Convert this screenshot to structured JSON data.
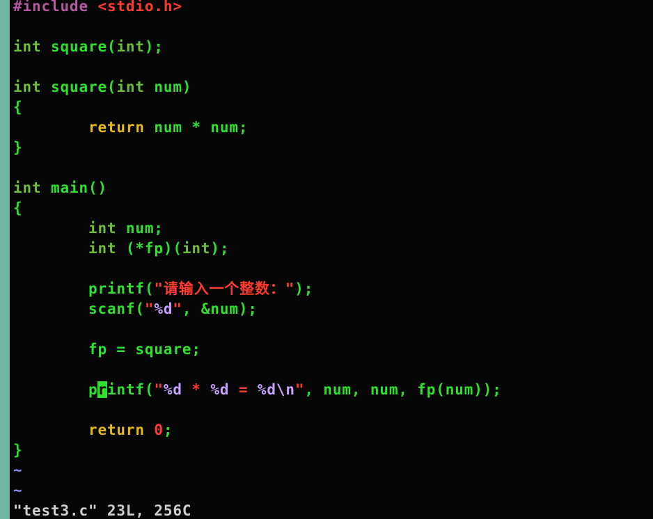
{
  "editor": {
    "lines": [
      {
        "indent": "",
        "tokens": [
          {
            "t": "#include ",
            "c": "pre"
          },
          {
            "t": "<stdio.h>",
            "c": "inc"
          }
        ]
      },
      {
        "indent": "",
        "tokens": []
      },
      {
        "indent": "",
        "tokens": [
          {
            "t": "int",
            "c": "type"
          },
          {
            "t": " square(",
            "c": "op"
          },
          {
            "t": "int",
            "c": "type"
          },
          {
            "t": ");",
            "c": "op"
          }
        ]
      },
      {
        "indent": "",
        "tokens": []
      },
      {
        "indent": "",
        "tokens": [
          {
            "t": "int",
            "c": "type"
          },
          {
            "t": " square(",
            "c": "op"
          },
          {
            "t": "int",
            "c": "type"
          },
          {
            "t": " num)",
            "c": "op"
          }
        ]
      },
      {
        "indent": "",
        "tokens": [
          {
            "t": "{",
            "c": "op"
          }
        ]
      },
      {
        "indent": "        ",
        "tokens": [
          {
            "t": "return",
            "c": "kw"
          },
          {
            "t": " num * num;",
            "c": "op"
          }
        ]
      },
      {
        "indent": "",
        "tokens": [
          {
            "t": "}",
            "c": "op"
          }
        ]
      },
      {
        "indent": "",
        "tokens": []
      },
      {
        "indent": "",
        "tokens": [
          {
            "t": "int",
            "c": "type"
          },
          {
            "t": " main()",
            "c": "op"
          }
        ]
      },
      {
        "indent": "",
        "tokens": [
          {
            "t": "{",
            "c": "op"
          }
        ]
      },
      {
        "indent": "        ",
        "tokens": [
          {
            "t": "int",
            "c": "type"
          },
          {
            "t": " num;",
            "c": "op"
          }
        ]
      },
      {
        "indent": "        ",
        "tokens": [
          {
            "t": "int",
            "c": "type"
          },
          {
            "t": " (*fp)(",
            "c": "op"
          },
          {
            "t": "int",
            "c": "type"
          },
          {
            "t": ");",
            "c": "op"
          }
        ]
      },
      {
        "indent": "",
        "tokens": []
      },
      {
        "indent": "        ",
        "tokens": [
          {
            "t": "printf(",
            "c": "op"
          },
          {
            "t": "\"请输入一个整数：\"",
            "c": "str"
          },
          {
            "t": ");",
            "c": "op"
          }
        ]
      },
      {
        "indent": "        ",
        "tokens": [
          {
            "t": "scanf(",
            "c": "op"
          },
          {
            "t": "\"",
            "c": "str"
          },
          {
            "t": "%d",
            "c": "fmt"
          },
          {
            "t": "\"",
            "c": "str"
          },
          {
            "t": ", &num);",
            "c": "op"
          }
        ]
      },
      {
        "indent": "",
        "tokens": []
      },
      {
        "indent": "        ",
        "tokens": [
          {
            "t": "fp = square;",
            "c": "op"
          }
        ]
      },
      {
        "indent": "",
        "tokens": []
      },
      {
        "indent": "        ",
        "tokens": [
          {
            "t": "p",
            "c": "op"
          },
          {
            "t": "r",
            "c": "cursor"
          },
          {
            "t": "intf(",
            "c": "op"
          },
          {
            "t": "\"",
            "c": "str"
          },
          {
            "t": "%d",
            "c": "fmt"
          },
          {
            "t": " * ",
            "c": "str"
          },
          {
            "t": "%d",
            "c": "fmt"
          },
          {
            "t": " = ",
            "c": "str"
          },
          {
            "t": "%d",
            "c": "fmt"
          },
          {
            "t": "\\n",
            "c": "esc"
          },
          {
            "t": "\"",
            "c": "str"
          },
          {
            "t": ", num, num, fp(num));",
            "c": "op"
          }
        ]
      },
      {
        "indent": "",
        "tokens": []
      },
      {
        "indent": "        ",
        "tokens": [
          {
            "t": "return",
            "c": "kw"
          },
          {
            "t": " ",
            "c": "op"
          },
          {
            "t": "0",
            "c": "num"
          },
          {
            "t": ";",
            "c": "op"
          }
        ]
      },
      {
        "indent": "",
        "tokens": [
          {
            "t": "}",
            "c": "op"
          }
        ]
      },
      {
        "indent": "",
        "tokens": [
          {
            "t": "~",
            "c": "tilde"
          }
        ]
      },
      {
        "indent": "",
        "tokens": [
          {
            "t": "~",
            "c": "tilde"
          }
        ]
      }
    ],
    "status_line": "\"test3.c\" 23L, 256C"
  },
  "colors": {
    "background": "#050505",
    "gutter": "#6fb7a4",
    "text": "#2fe02f",
    "keyword": "#e5b81b",
    "type": "#6cbd3a",
    "string": "#ff3b30",
    "format": "#c8a2ff",
    "preprocessor": "#b55aa0"
  }
}
